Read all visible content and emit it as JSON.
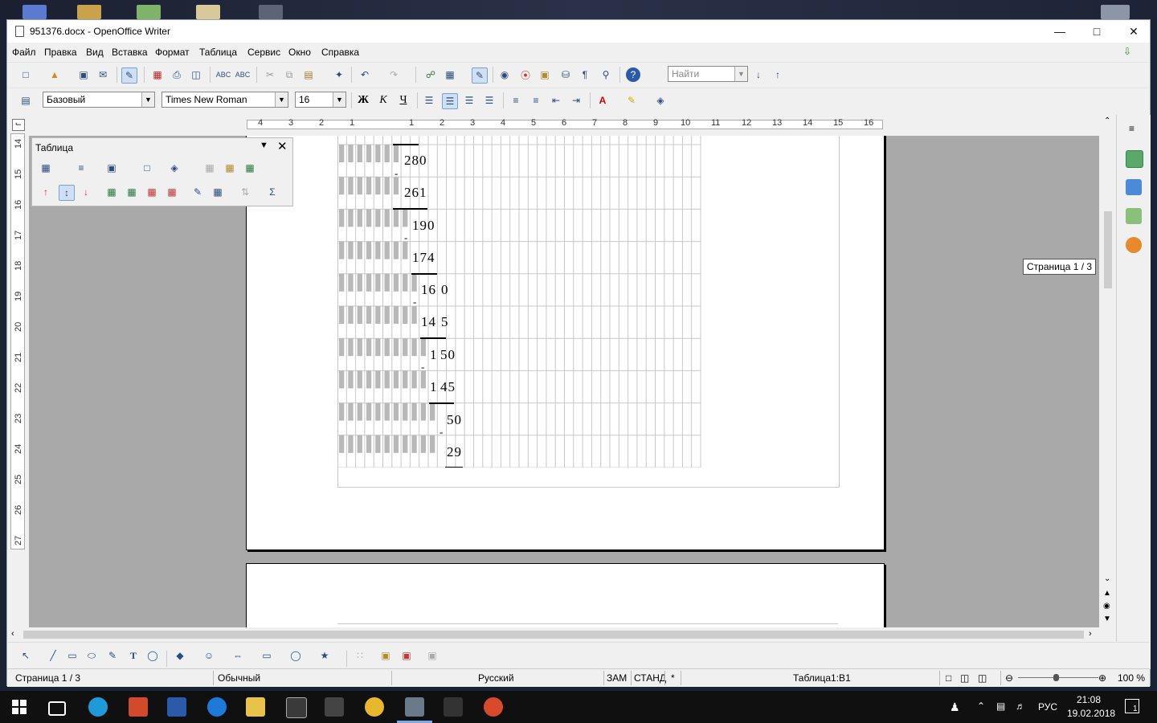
{
  "window": {
    "title": "951376.docx - OpenOffice Writer"
  },
  "menu": [
    "Файл",
    "Правка",
    "Вид",
    "Вставка",
    "Формат",
    "Таблица",
    "Сервис",
    "Окно",
    "Справка"
  ],
  "toolbar": {
    "find_placeholder": "Найти"
  },
  "format": {
    "style": "Базовый",
    "font": "Times New Roman",
    "size": "16",
    "bold": "Ж",
    "italic": "К",
    "underline": "Ч"
  },
  "ruler": {
    "h_ticks": [
      "4",
      "3",
      "2",
      "1",
      "1",
      "2",
      "3",
      "4",
      "5",
      "6",
      "7",
      "8",
      "9",
      "10",
      "11",
      "12",
      "13",
      "14",
      "15",
      "16"
    ],
    "v_ticks": [
      "14",
      "15",
      "16",
      "17",
      "18",
      "19",
      "20",
      "21",
      "22",
      "23",
      "24",
      "25",
      "26",
      "27"
    ]
  },
  "table_toolbar": {
    "title": "Таблица"
  },
  "document": {
    "division_numbers": [
      "280",
      "261",
      "190",
      "174",
      "16",
      "0",
      "14",
      "5",
      "1",
      "50",
      "1",
      "45",
      "50",
      "29"
    ],
    "minus": "-"
  },
  "tooltip": "Страница  1 / 3",
  "status": {
    "page": "Страница  1 / 3",
    "style": "Обычный",
    "language": "Русский",
    "mode1": "ЗАМ",
    "mode2": "СТАНД",
    "modified": "*",
    "cell": "Таблица1:B1",
    "zoom": "100 %"
  },
  "taskbar": {
    "lang": "РУС",
    "time": "21:08",
    "date": "19.02.2018",
    "notif": "1"
  }
}
